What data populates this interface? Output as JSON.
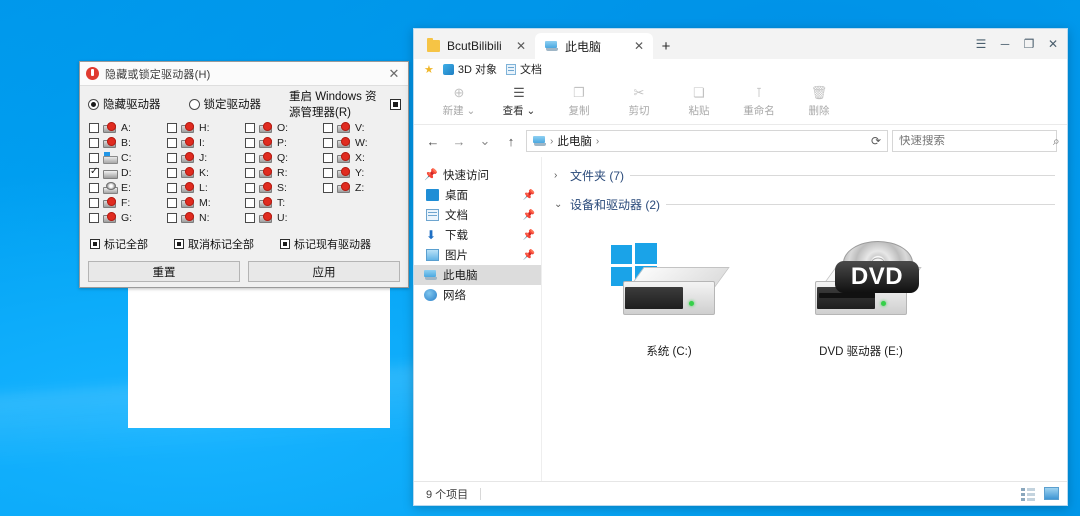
{
  "desktop": {
    "background_color": "#00a2f3"
  },
  "dialog": {
    "title": "隐藏或锁定驱动器(H)",
    "close_label": "✕",
    "options": {
      "hide_label": "隐藏驱动器",
      "lock_label": "锁定驱动器",
      "restart_explorer_label": "重启 Windows 资源管理器(R)",
      "selected": "隐藏驱动器"
    },
    "drives": [
      {
        "letter": "A:",
        "checked": false,
        "icon": "missing-drive-icon"
      },
      {
        "letter": "B:",
        "checked": false,
        "icon": "missing-drive-icon"
      },
      {
        "letter": "C:",
        "checked": false,
        "icon": "hard-disk-icon"
      },
      {
        "letter": "D:",
        "checked": true,
        "icon": "drive-icon"
      },
      {
        "letter": "E:",
        "checked": false,
        "icon": "optical-drive-icon"
      },
      {
        "letter": "F:",
        "checked": false,
        "icon": "missing-drive-icon"
      },
      {
        "letter": "G:",
        "checked": false,
        "icon": "missing-drive-icon"
      },
      {
        "letter": "H:",
        "checked": false,
        "icon": "missing-drive-icon"
      },
      {
        "letter": "I:",
        "checked": false,
        "icon": "missing-drive-icon"
      },
      {
        "letter": "J:",
        "checked": false,
        "icon": "missing-drive-icon"
      },
      {
        "letter": "K:",
        "checked": false,
        "icon": "missing-drive-icon"
      },
      {
        "letter": "L:",
        "checked": false,
        "icon": "missing-drive-icon"
      },
      {
        "letter": "M:",
        "checked": false,
        "icon": "missing-drive-icon"
      },
      {
        "letter": "N:",
        "checked": false,
        "icon": "missing-drive-icon"
      },
      {
        "letter": "O:",
        "checked": false,
        "icon": "missing-drive-icon"
      },
      {
        "letter": "P:",
        "checked": false,
        "icon": "missing-drive-icon"
      },
      {
        "letter": "Q:",
        "checked": false,
        "icon": "missing-drive-icon"
      },
      {
        "letter": "R:",
        "checked": false,
        "icon": "missing-drive-icon"
      },
      {
        "letter": "S:",
        "checked": false,
        "icon": "missing-drive-icon"
      },
      {
        "letter": "T:",
        "checked": false,
        "icon": "missing-drive-icon"
      },
      {
        "letter": "U:",
        "checked": false,
        "icon": "missing-drive-icon"
      },
      {
        "letter": "V:",
        "checked": false,
        "icon": "missing-drive-icon"
      },
      {
        "letter": "W:",
        "checked": false,
        "icon": "missing-drive-icon"
      },
      {
        "letter": "X:",
        "checked": false,
        "icon": "missing-drive-icon"
      },
      {
        "letter": "Y:",
        "checked": false,
        "icon": "missing-drive-icon"
      },
      {
        "letter": "Z:",
        "checked": false,
        "icon": "missing-drive-icon"
      }
    ],
    "mark_buttons": [
      {
        "label": "标记全部"
      },
      {
        "label": "取消标记全部"
      },
      {
        "label": "标记现有驱动器"
      }
    ],
    "action_buttons": {
      "reset_label": "重置",
      "apply_label": "应用"
    }
  },
  "explorer": {
    "tabs": [
      {
        "label": "BcutBilibili",
        "icon": "folder-icon",
        "active": false,
        "close_label": "✕"
      },
      {
        "label": "此电脑",
        "icon": "this-pc-icon",
        "active": true,
        "close_label": "✕"
      }
    ],
    "new_tab_label": "+",
    "window_controls": {
      "menu_label": "☰",
      "minimize_label": "─",
      "maximize_label": "❐",
      "close_label": "✕"
    },
    "quick_access_toolbar": [
      {
        "label": "",
        "icon": "star-icon"
      },
      {
        "label": "3D 对象",
        "icon": "3d-objects-icon"
      },
      {
        "label": "文档",
        "icon": "documents-icon"
      }
    ],
    "commands": [
      {
        "label": "新建 ⌄",
        "icon": "new-icon",
        "enabled": false
      },
      {
        "label": "查看 ⌄",
        "icon": "view-icon",
        "enabled": true
      },
      {
        "label": "复制",
        "icon": "copy-icon",
        "enabled": false
      },
      {
        "label": "剪切",
        "icon": "cut-icon",
        "enabled": false
      },
      {
        "label": "粘贴",
        "icon": "paste-icon",
        "enabled": false
      },
      {
        "label": "重命名",
        "icon": "rename-icon",
        "enabled": false
      },
      {
        "label": "删除",
        "icon": "delete-icon",
        "enabled": false
      }
    ],
    "navigation": {
      "back_label": "←",
      "forward_label": "→",
      "recent_label": "⌄",
      "up_label": "↑",
      "refresh_label": "⟳"
    },
    "address": {
      "crumb": "此电脑",
      "separator": "›",
      "leading_separator": "›"
    },
    "search": {
      "placeholder": "快速搜索",
      "value": "",
      "icon": "search-icon"
    },
    "nav_pane": [
      {
        "label": "快速访问",
        "icon": "pin-icon",
        "pinned": false,
        "selected": false,
        "root": true
      },
      {
        "label": "桌面",
        "icon": "desktop-icon",
        "pinned": true,
        "selected": false,
        "root": false
      },
      {
        "label": "文档",
        "icon": "documents-icon",
        "pinned": true,
        "selected": false,
        "root": false
      },
      {
        "label": "下载",
        "icon": "downloads-icon",
        "pinned": true,
        "selected": false,
        "root": false
      },
      {
        "label": "图片",
        "icon": "pictures-icon",
        "pinned": true,
        "selected": false,
        "root": false
      },
      {
        "label": "此电脑",
        "icon": "this-pc-icon",
        "pinned": false,
        "selected": true,
        "root": true
      },
      {
        "label": "网络",
        "icon": "network-icon",
        "pinned": false,
        "selected": false,
        "root": true
      }
    ],
    "groups": [
      {
        "title": "文件夹 (7)",
        "expanded": false,
        "chevron": "›"
      },
      {
        "title": "设备和驱动器 (2)",
        "expanded": true,
        "chevron": "⌄"
      }
    ],
    "drives": [
      {
        "name": "系统 (C:)",
        "type": "windows-system-drive",
        "badge": ""
      },
      {
        "name": "DVD 驱动器 (E:)",
        "type": "dvd-drive",
        "badge": "DVD"
      }
    ],
    "status": {
      "item_count": "9 个项目",
      "view_details_icon": "details-view-icon",
      "view_icons_icon": "large-icons-view-icon"
    }
  }
}
